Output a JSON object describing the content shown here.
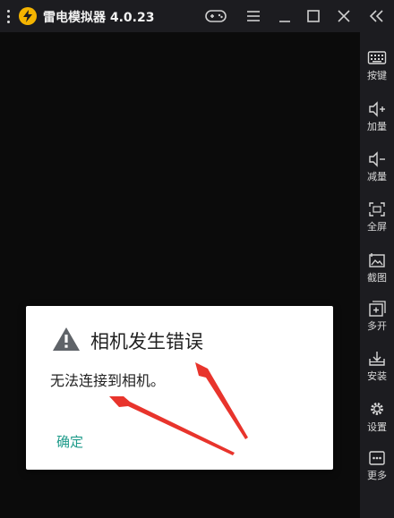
{
  "app": {
    "title": "雷电模拟器 4.0.23",
    "logo_color": "#f4b400"
  },
  "titlebar": {
    "icons": [
      "menu-dots-icon",
      "gamepad-icon",
      "hamburger-menu-icon",
      "minimize-icon",
      "maximize-icon",
      "close-icon",
      "collapse-sidebar-icon"
    ]
  },
  "sidebar": {
    "items": [
      {
        "label": "按键",
        "icon": "keyboard-icon"
      },
      {
        "label": "加量",
        "icon": "volume-up-icon"
      },
      {
        "label": "减量",
        "icon": "volume-down-icon"
      },
      {
        "label": "全屏",
        "icon": "fullscreen-icon"
      },
      {
        "label": "截图",
        "icon": "screenshot-icon"
      },
      {
        "label": "多开",
        "icon": "multi-instance-icon"
      },
      {
        "label": "安装",
        "icon": "install-icon"
      },
      {
        "label": "设置",
        "icon": "settings-icon"
      },
      {
        "label": "更多",
        "icon": "more-icon"
      }
    ]
  },
  "dialog": {
    "title": "相机发生错误",
    "message": "无法连接到相机。",
    "confirm_label": "确定",
    "icon": "warning-icon",
    "accent_color": "#1e9b8a"
  },
  "annotations": {
    "arrow_color": "#e8342c"
  }
}
